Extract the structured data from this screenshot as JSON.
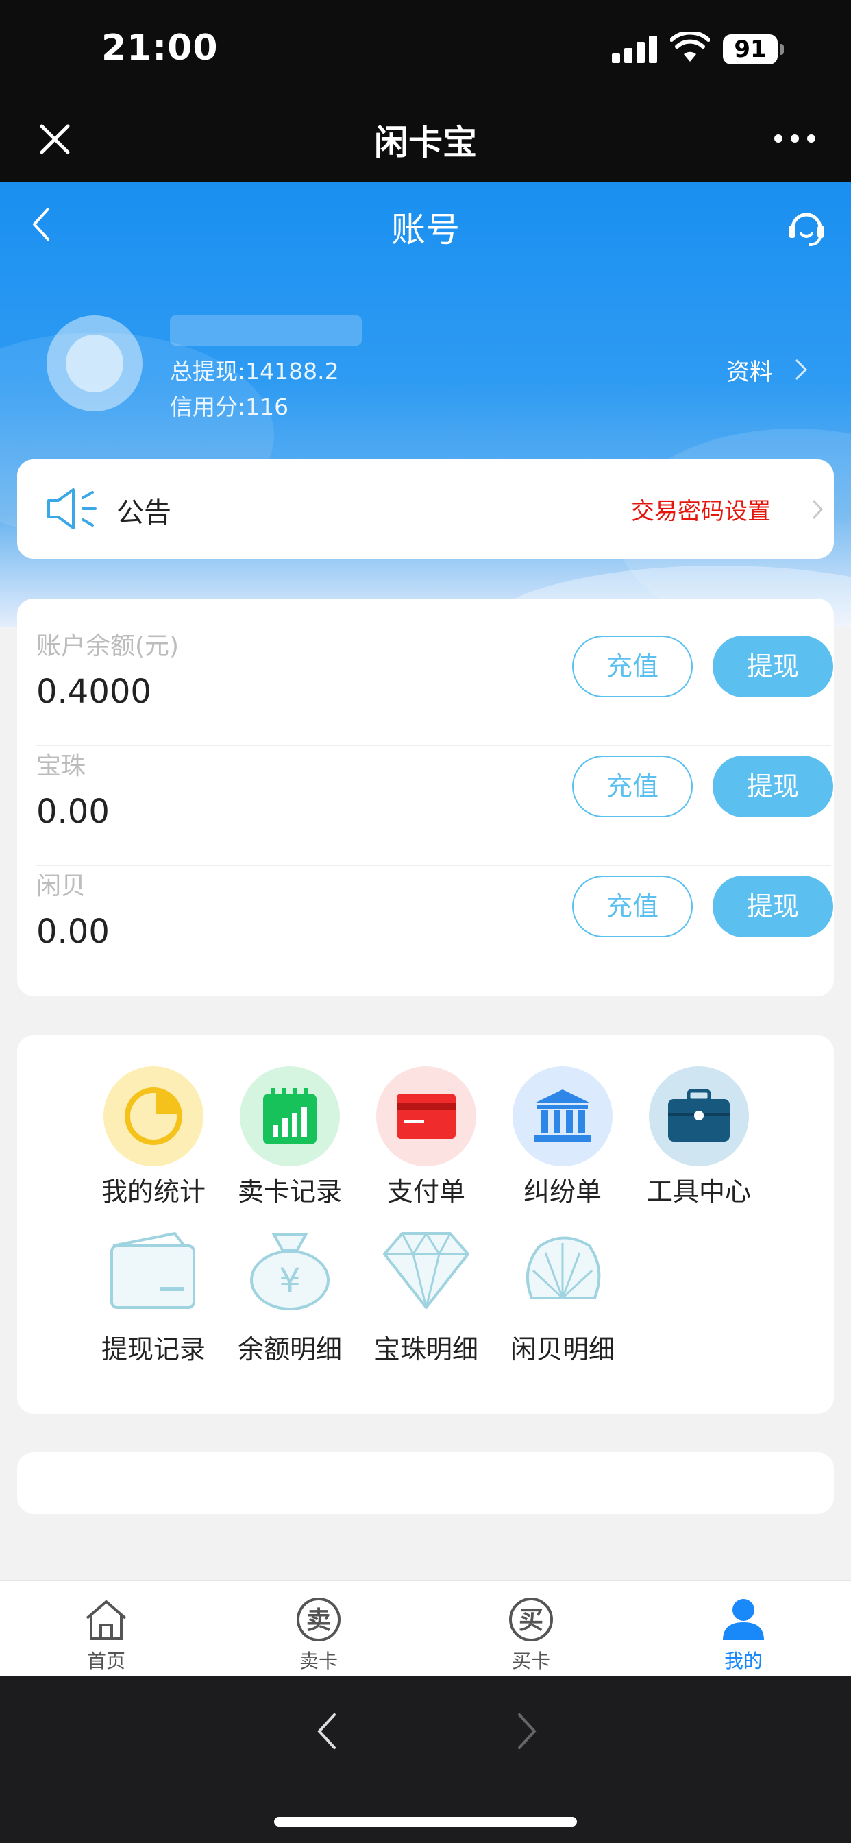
{
  "status_bar": {
    "time": "21:00",
    "battery": "91"
  },
  "webview": {
    "title": "闲卡宝",
    "close_icon": "close-icon",
    "more_icon": "more-icon"
  },
  "page": {
    "title": "账号",
    "back_icon": "back-icon",
    "service_icon": "customer-service-icon"
  },
  "profile": {
    "total_withdraw": "总提现:14188.2",
    "credit": "信用分:116",
    "link_label": "资料"
  },
  "notice": {
    "label": "公告",
    "password_link": "交易密码设置"
  },
  "balances": [
    {
      "label": "账户余额(元)",
      "value": "0.4000",
      "recharge": "充值",
      "withdraw": "提现"
    },
    {
      "label": "宝珠",
      "value": "0.00",
      "recharge": "充值",
      "withdraw": "提现"
    },
    {
      "label": "闲贝",
      "value": "0.00",
      "recharge": "充值",
      "withdraw": "提现"
    }
  ],
  "tools": [
    {
      "label": "我的统计",
      "icon": "pie-chart-icon",
      "color": "#fcd34d"
    },
    {
      "label": "卖卡记录",
      "icon": "bar-chart-icon",
      "color": "#22c55e"
    },
    {
      "label": "支付单",
      "icon": "card-icon",
      "color": "#ef4444"
    },
    {
      "label": "纠纷单",
      "icon": "bank-icon",
      "color": "#3b82f6"
    },
    {
      "label": "工具中心",
      "icon": "briefcase-icon",
      "color": "#1e5f8a"
    },
    {
      "label": "提现记录",
      "icon": "wallet-icon",
      "color": "#9fd3e0"
    },
    {
      "label": "余额明细",
      "icon": "money-bag-icon",
      "color": "#9fd3e0"
    },
    {
      "label": "宝珠明细",
      "icon": "diamond-icon",
      "color": "#9fd3e0"
    },
    {
      "label": "闲贝明细",
      "icon": "shell-icon",
      "color": "#9fd3e0"
    }
  ],
  "tabbar": [
    {
      "label": "首页",
      "icon": "home-icon"
    },
    {
      "label": "卖卡",
      "icon": "sell-icon",
      "glyph": "卖"
    },
    {
      "label": "买卡",
      "icon": "buy-icon",
      "glyph": "买"
    },
    {
      "label": "我的",
      "icon": "user-icon",
      "active": true
    }
  ],
  "colors": {
    "primary": "#1a8ff0",
    "accent": "#5bc0f0",
    "warning": "#e4170d",
    "tab_active": "#1989fa"
  }
}
